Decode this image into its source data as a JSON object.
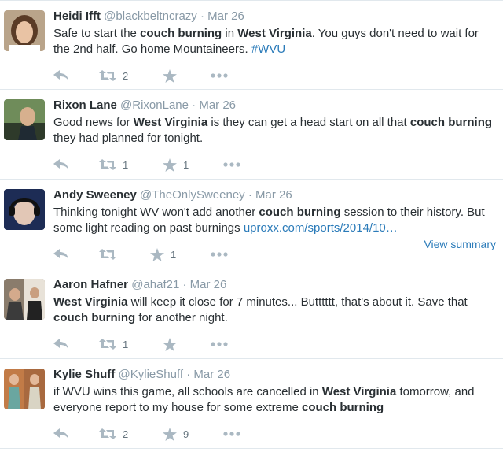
{
  "tweets": [
    {
      "name": "Heidi Ifft",
      "handle": "@blackbeltncrazy",
      "time": "Mar 26",
      "text": [
        {
          "t": "Safe to start the "
        },
        {
          "t": "couch burning",
          "b": true
        },
        {
          "t": " in "
        },
        {
          "t": "West Virginia",
          "b": true
        },
        {
          "t": ". You guys don't need to wait for the 2nd half. Go home Mountaineers. "
        },
        {
          "t": "#WVU",
          "link": true
        }
      ],
      "retweets": "2",
      "favorites": ""
    },
    {
      "name": "Rixon Lane",
      "handle": "@RixonLane",
      "time": "Mar 26",
      "text": [
        {
          "t": "Good news for "
        },
        {
          "t": "West Virginia",
          "b": true
        },
        {
          "t": " is they can get a head start on all that "
        },
        {
          "t": "couch burning",
          "b": true
        },
        {
          "t": " they had planned for tonight."
        }
      ],
      "retweets": "1",
      "favorites": "1"
    },
    {
      "name": "Andy Sweeney",
      "handle": "@TheOnlySweeney",
      "time": "Mar 26",
      "text": [
        {
          "t": "Thinking tonight WV won't add another "
        },
        {
          "t": "couch burning",
          "b": true
        },
        {
          "t": " session to their history. But some light reading on past burnings "
        },
        {
          "t": "uproxx.com/sports/2014/10…",
          "link": true
        }
      ],
      "retweets": "",
      "favorites": "1",
      "summary": "View summary"
    },
    {
      "name": "Aaron Hafner",
      "handle": "@ahaf21",
      "time": "Mar 26",
      "text": [
        {
          "t": "West Virginia",
          "b": true
        },
        {
          "t": " will keep it close for 7 minutes... Butttttt, that's about it. Save that "
        },
        {
          "t": "couch burning",
          "b": true
        },
        {
          "t": " for another night."
        }
      ],
      "retweets": "1",
      "favorites": ""
    },
    {
      "name": "Kylie Shuff",
      "handle": "@KylieShuff",
      "time": "Mar 26",
      "text": [
        {
          "t": "if WVU wins this game, all schools are cancelled in "
        },
        {
          "t": "West Virginia",
          "b": true
        },
        {
          "t": " tomorrow, and everyone report to my house for some extreme "
        },
        {
          "t": "couch burning",
          "b": true
        }
      ],
      "retweets": "2",
      "favorites": "9"
    }
  ],
  "header_separator": "·",
  "icons": {
    "reply": "reply-icon",
    "retweet": "retweet-icon",
    "favorite": "star-icon",
    "more": "more-dots-icon"
  },
  "colors": {
    "text": "#292f33",
    "muted": "#8899a6",
    "link": "#2b7bb9",
    "icon": "#aab8c2",
    "divider": "#e1e8ed"
  }
}
